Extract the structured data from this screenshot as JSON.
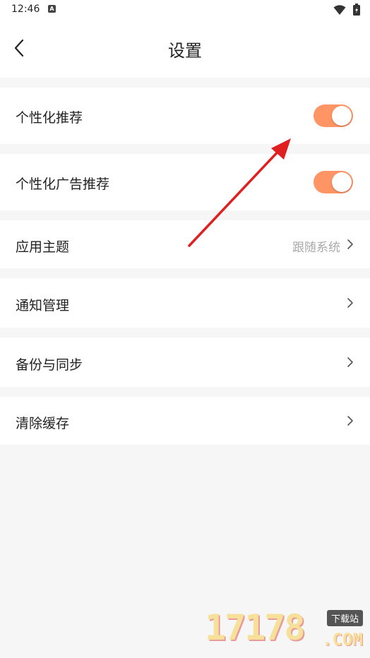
{
  "status_bar": {
    "time": "12:46",
    "notification_icon": "A"
  },
  "header": {
    "title": "设置",
    "back_icon": "chevron-left-icon"
  },
  "settings": {
    "personalized_recommendation": {
      "label": "个性化推荐",
      "enabled": true
    },
    "personalized_ad_recommendation": {
      "label": "个性化广告推荐",
      "enabled": true
    },
    "app_theme": {
      "label": "应用主题",
      "value": "跟随系统"
    },
    "notification_management": {
      "label": "通知管理"
    },
    "backup_sync": {
      "label": "备份与同步"
    },
    "clear_cache": {
      "label": "清除缓存"
    }
  },
  "colors": {
    "toggle_on": "#ff9464",
    "annotation_arrow": "#e02020",
    "background": "#f6f6f6"
  },
  "watermark": {
    "number": "17178",
    "suffix": ".COM",
    "tag": "下载站"
  }
}
